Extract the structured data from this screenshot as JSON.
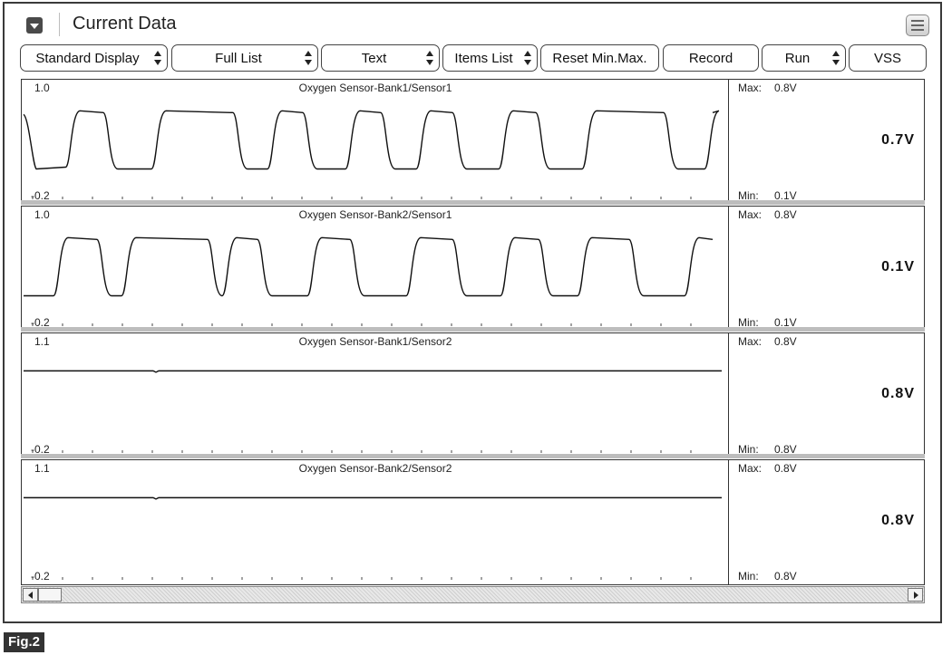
{
  "header": {
    "title": "Current Data"
  },
  "toolbar": [
    {
      "label": "Standard Display",
      "spinner": true
    },
    {
      "label": "Full List",
      "spinner": true
    },
    {
      "label": "Text",
      "spinner": true
    },
    {
      "label": "Items List",
      "spinner": true
    },
    {
      "label": "Reset Min.Max.",
      "spinner": false
    },
    {
      "label": "Record",
      "spinner": false
    },
    {
      "label": "Run",
      "spinner": true
    },
    {
      "label": "VSS",
      "spinner": false
    }
  ],
  "panels": [
    {
      "title": "Oxygen Sensor-Bank1/Sensor1",
      "y_max_label": "1.0",
      "y_min_label": "-0.2",
      "max_label": "Max:",
      "max_value": "0.8V",
      "min_label": "Min:",
      "min_value": "0.1V",
      "current_value": "0.7V",
      "trace": "square-wave",
      "trace_min_v": 0.1,
      "trace_max_v": 0.8
    },
    {
      "title": "Oxygen Sensor-Bank2/Sensor1",
      "y_max_label": "1.0",
      "y_min_label": "-0.2",
      "max_label": "Max:",
      "max_value": "0.8V",
      "min_label": "Min:",
      "min_value": "0.1V",
      "current_value": "0.1V",
      "trace": "square-wave",
      "trace_min_v": 0.1,
      "trace_max_v": 0.8
    },
    {
      "title": "Oxygen Sensor-Bank1/Sensor2",
      "y_max_label": "1.1",
      "y_min_label": "-0.2",
      "max_label": "Max:",
      "max_value": "0.8V",
      "min_label": "Min:",
      "min_value": "0.8V",
      "current_value": "0.8V",
      "trace": "flat",
      "trace_level_v": 0.8
    },
    {
      "title": "Oxygen Sensor-Bank2/Sensor2",
      "y_max_label": "1.1",
      "y_min_label": "-0.2",
      "max_label": "Max:",
      "max_value": "0.8V",
      "min_label": "Min:",
      "min_value": "0.8V",
      "current_value": "0.8V",
      "trace": "flat",
      "trace_level_v": 0.8
    }
  ],
  "figure": {
    "label": "Fig.2"
  },
  "icons": {
    "collapse": "collapse-arrow-icon",
    "menu": "list-menu-icon",
    "scroll_left": "arrow-left-icon",
    "scroll_right": "arrow-right-icon"
  },
  "colors": {
    "frame": "#333333",
    "trace": "#111111",
    "separator": "#bdbdbd",
    "figure_badge": "#333333"
  }
}
